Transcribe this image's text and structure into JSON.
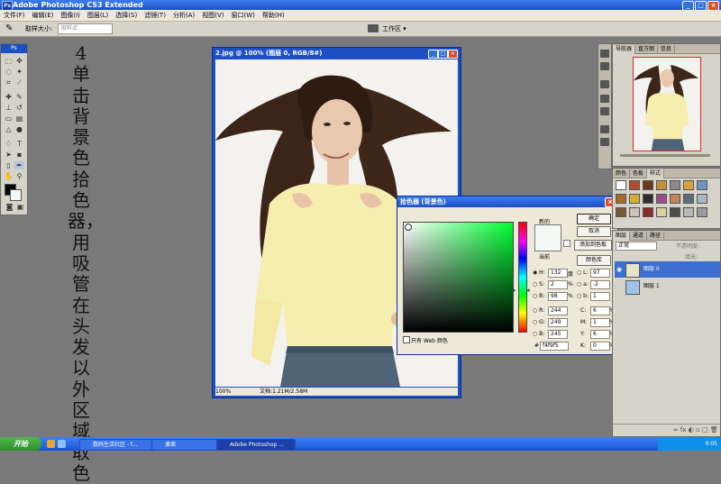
{
  "app": {
    "title": "Adobe Photoshop CS3 Extended"
  },
  "menu": [
    "文件(F)",
    "编辑(E)",
    "图像(I)",
    "图层(L)",
    "选择(S)",
    "滤镜(T)",
    "分析(A)",
    "视图(V)",
    "窗口(W)",
    "帮助(H)"
  ],
  "options": {
    "sample_label": "取样大小:",
    "sample_value": "取样点",
    "workspace": "工作区 ▾"
  },
  "toolbox": {
    "header": "Ps"
  },
  "instruction": {
    "number": "4",
    "text": "单击背景色拾色器，用吸管在头发以外区域取色"
  },
  "document": {
    "title": "2.jpg @ 100% (图层 0, RGB/8#)",
    "zoom": "100%",
    "status": "文档:1.21M/2.58M"
  },
  "picker": {
    "title": "拾色器 (背景色)",
    "new_label": "新的",
    "current_label": "当前",
    "buttons": {
      "ok": "确定",
      "cancel": "取消",
      "add_swatch": "添加到色板",
      "libraries": "颜色库"
    },
    "web_only": "只有 Web 颜色",
    "hsb": {
      "h": "132",
      "h_unit": "度",
      "s": "2",
      "b": "98"
    },
    "rgb": {
      "r": "244",
      "g": "249",
      "b": "245"
    },
    "lab": {
      "l": "97",
      "a": "-2",
      "b": "1"
    },
    "cmyk": {
      "c": "6",
      "m": "1",
      "y": "6",
      "k": "0"
    },
    "hex": "f4f9f5",
    "colors": {
      "new": "#f4f9f5"
    }
  },
  "panels": {
    "navigator_tabs": [
      "导航器",
      "直方图",
      "信息"
    ],
    "color_tabs": [
      "颜色",
      "色板",
      "样式"
    ],
    "layers_tabs": [
      "图层",
      "通道",
      "路径"
    ],
    "layers_mode": "正常",
    "layers_opacity_label": "不透明度:",
    "layers_fill_label": "填充:",
    "layers": [
      {
        "name": "图层 0"
      },
      {
        "name": "图层 1"
      }
    ]
  },
  "taskbar": {
    "start": "开始",
    "tasks": [
      "数码生活社区 - f...",
      "桌面",
      "Adobe Photoshop ..."
    ],
    "clock": "9:05"
  }
}
